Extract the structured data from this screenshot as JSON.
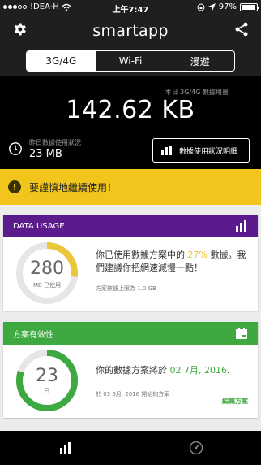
{
  "status_bar": {
    "carrier": "!DEA-H",
    "time": "上午7:47",
    "battery": "97%",
    "battery_level": 0.97
  },
  "header": {
    "app_title": "smartapp"
  },
  "tabs": [
    {
      "label": "3G/4G",
      "active": true
    },
    {
      "label": "Wi-Fi",
      "active": false
    },
    {
      "label": "漫遊",
      "active": false
    }
  ],
  "usage": {
    "label": "本日 3G/4G 數據用量",
    "amount": "142.62 KB",
    "yesterday_label": "昨日數據使用狀況",
    "yesterday_value": "23 MB",
    "details_button": "數據使用狀況明細"
  },
  "warning": {
    "text": "要謹慎地繼續使用！"
  },
  "data_usage_card": {
    "title": "DATA USAGE",
    "donut_value": "280",
    "donut_caption": "MB 已使用",
    "progress": 0.27,
    "message_prefix": "你已使用數據方案中的 ",
    "message_percent": "27%",
    "message_suffix": " 數據。我們建議你把網速減慢一點！",
    "limit_text": "方案數據上限為 1.0 GB"
  },
  "plan_card": {
    "title": "方案有效性",
    "donut_value": "23",
    "donut_caption": "日",
    "progress": 0.8,
    "message_prefix": "你的數據方案將於 ",
    "message_date": "02 7月, 2016",
    "message_suffix": ".",
    "start_text": "於 03 6月, 2016 開始的方案",
    "edit_link": "編輯方案"
  },
  "colors": {
    "accent_purple": "#5b1b8c",
    "accent_green": "#3ea940",
    "warning_yellow": "#f2c51c",
    "progress_yellow": "#e9c63a"
  },
  "icons": {
    "settings": "gear-icon",
    "share": "share-icon",
    "clock": "clock-icon",
    "bar_chart": "bar-chart-icon",
    "warning": "exclamation-icon",
    "calendar": "calendar-icon",
    "speedometer": "speedometer-icon"
  }
}
